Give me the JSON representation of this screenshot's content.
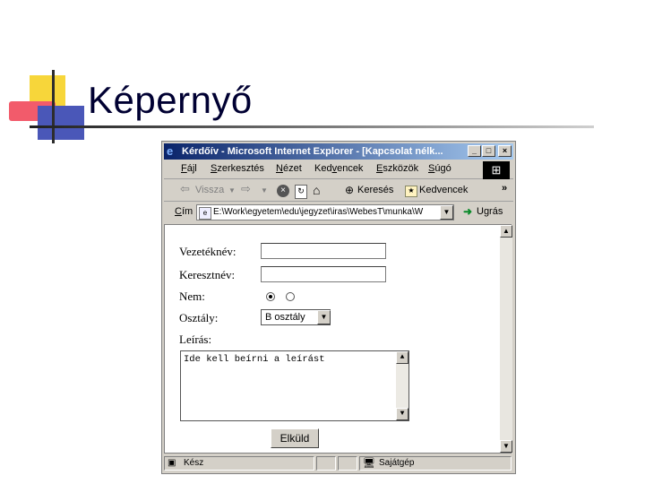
{
  "slide": {
    "title": "Képernyő"
  },
  "window": {
    "title": "Kérdőív - Microsoft Internet Explorer - [Kapcsolat nélk...",
    "controls": {
      "minimize": "_",
      "maximize": "□",
      "close": "×"
    }
  },
  "menu": {
    "items": [
      {
        "pre": "",
        "u": "F",
        "post": "ájl"
      },
      {
        "pre": "",
        "u": "S",
        "post": "zerkesztés"
      },
      {
        "pre": "",
        "u": "N",
        "post": "ézet"
      },
      {
        "pre": "Ked",
        "u": "v",
        "post": "encek"
      },
      {
        "pre": "",
        "u": "E",
        "post": "szközök"
      },
      {
        "pre": "",
        "u": "S",
        "post": "úgó"
      }
    ]
  },
  "toolbar": {
    "back": "Vissza",
    "search": "Keresés",
    "favorites": "Kedvencek",
    "more": "»"
  },
  "address": {
    "label_pre": "",
    "label_u": "C",
    "label_post": "ím",
    "value": "E:\\Work\\egyetem\\edu\\jegyzet\\iras\\WebesT\\munka\\W",
    "go": "Ugrás"
  },
  "form": {
    "surname_label": "Vezetéknév:",
    "firstname_label": "Keresztnév:",
    "gender_label": "Nem:",
    "class_label": "Osztály:",
    "class_value": "B osztály",
    "description_label": "Leírás:",
    "description_value": "Ide kell beírni a leírást",
    "submit": "Elküld"
  },
  "status": {
    "ready": "Kész",
    "zone": "Sajátgép"
  },
  "colors": {
    "titlebar_start": "#0a246a",
    "titlebar_end": "#a6caf0",
    "window_face": "#d4d0c8"
  }
}
